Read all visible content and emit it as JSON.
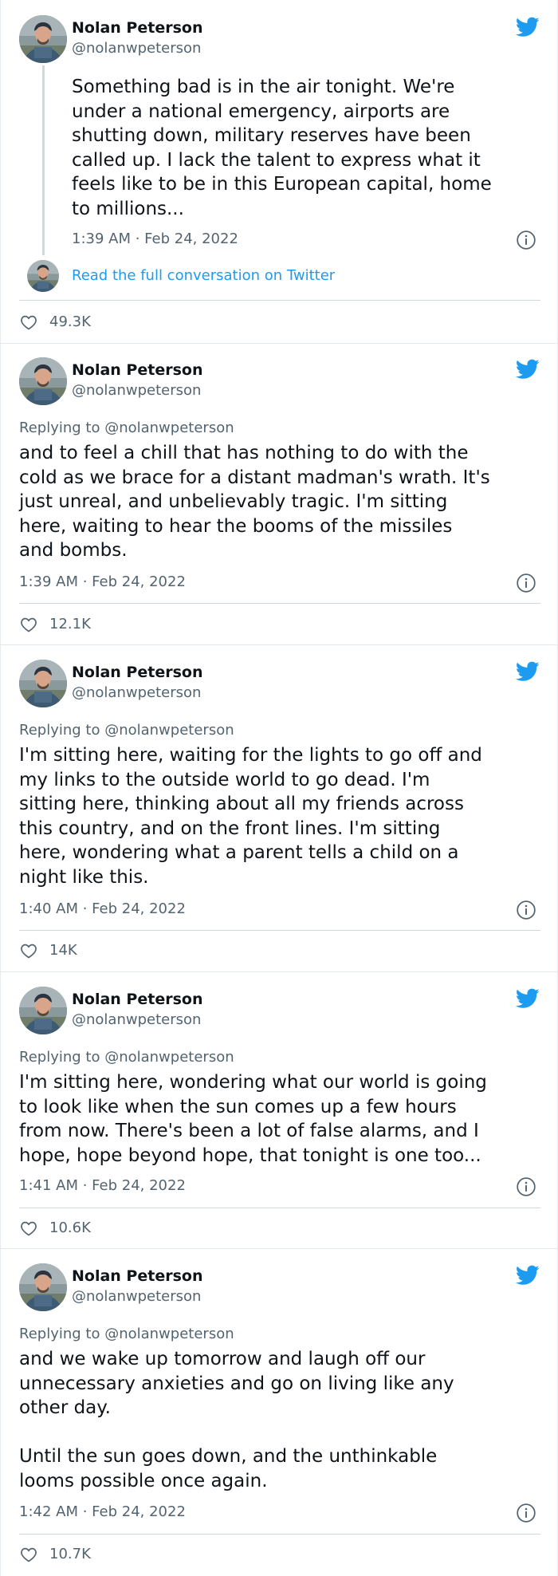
{
  "author": {
    "name": "Nolan Peterson",
    "handle": "@nolanwpeterson"
  },
  "thread_link": "Read the full conversation on Twitter",
  "replying_to": "Replying to @nolanwpeterson",
  "tweets": [
    {
      "text": "Something bad is in the air tonight. We're\nunder a national emergency, airports are\nshutting down, military reserves have been\ncalled up. I lack the talent to express what it\nfeels like to be in this European capital, home\nto millions...",
      "timestamp": "1:39 AM · Feb 24, 2022",
      "likes": "49.3K"
    },
    {
      "text": "and to feel a chill that has nothing to do with the\ncold as we brace for a distant madman's wrath. It's\njust unreal, and unbelievably tragic. I'm sitting\nhere, waiting to hear the booms of the missiles\nand bombs.",
      "timestamp": "1:39 AM · Feb 24, 2022",
      "likes": "12.1K"
    },
    {
      "text": "I'm sitting here, waiting for the lights to go off and\nmy links to the outside world to go dead. I'm\nsitting here, thinking about all my friends across\nthis country, and on the front lines. I'm sitting\nhere, wondering what a parent tells a child on a\nnight like this.",
      "timestamp": "1:40 AM · Feb 24, 2022",
      "likes": "14K"
    },
    {
      "text": "I'm sitting here, wondering what our world is going\nto look like when the sun comes up a few hours\nfrom now. There's been a lot of false alarms, and I\nhope, hope beyond hope, that tonight is one too...",
      "timestamp": "1:41 AM · Feb 24, 2022",
      "likes": "10.6K"
    },
    {
      "text": "and we wake up tomorrow and laugh off our\nunnecessary anxieties and go on living like any\nother day.\n\nUntil the sun goes down, and the unthinkable\nlooms possible once again.",
      "timestamp": "1:42 AM · Feb 24, 2022",
      "likes": "10.7K"
    }
  ],
  "icons": {
    "bird": "twitter-bird-icon",
    "info": "info-icon",
    "heart": "heart-icon"
  },
  "colors": {
    "brand_blue": "#1d9bf0",
    "text": "#0f1419",
    "muted": "#536471"
  }
}
